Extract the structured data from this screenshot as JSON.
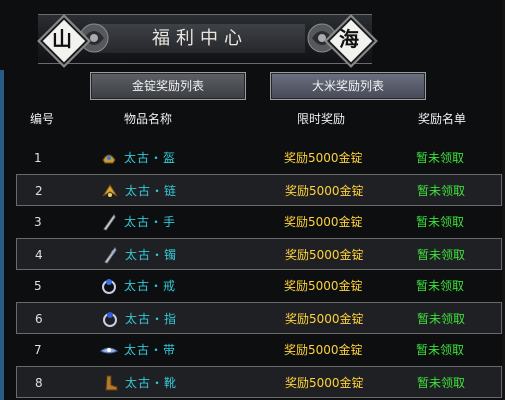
{
  "banner": {
    "title": "福利中心",
    "left_char": "山",
    "right_char": "海"
  },
  "tabs": [
    {
      "label": "金锭奖励列表"
    },
    {
      "label": "大米奖励列表"
    }
  ],
  "table": {
    "headers": {
      "num": "编号",
      "name": "物品名称",
      "reward": "限时奖励",
      "list": "奖励名单"
    },
    "rows": [
      {
        "num": "1",
        "name": "太古・盔",
        "reward": "奖励5000金锭",
        "status": "暂未领取",
        "icon": "helmet-icon"
      },
      {
        "num": "2",
        "name": "太古・链",
        "reward": "奖励5000金锭",
        "status": "暂未领取",
        "icon": "necklace-icon"
      },
      {
        "num": "3",
        "name": "太古・手",
        "reward": "奖励5000金锭",
        "status": "暂未领取",
        "icon": "bracer-icon"
      },
      {
        "num": "4",
        "name": "太古・镯",
        "reward": "奖励5000金锭",
        "status": "暂未领取",
        "icon": "bracelet-icon"
      },
      {
        "num": "5",
        "name": "太古・戒",
        "reward": "奖励5000金锭",
        "status": "暂未领取",
        "icon": "ring-icon"
      },
      {
        "num": "6",
        "name": "太古・指",
        "reward": "奖励5000金锭",
        "status": "暂未领取",
        "icon": "finger-ring-icon"
      },
      {
        "num": "7",
        "name": "太古・带",
        "reward": "奖励5000金锭",
        "status": "暂未领取",
        "icon": "belt-icon"
      },
      {
        "num": "8",
        "name": "太古・靴",
        "reward": "奖励5000金锭",
        "status": "暂未领取",
        "icon": "boots-icon"
      }
    ]
  },
  "colors": {
    "item_name": "#33c9d6",
    "reward": "#ffd23a",
    "status": "#3ee03a"
  }
}
